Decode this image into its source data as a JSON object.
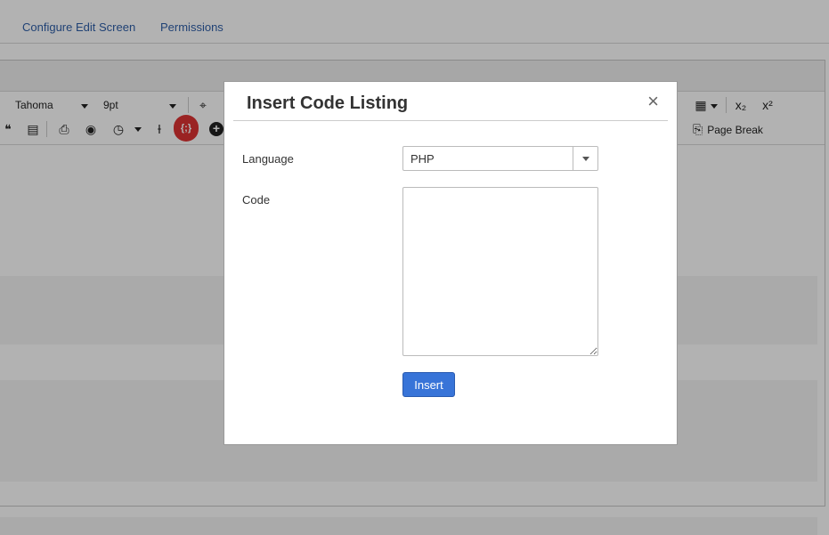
{
  "top_tabs": [
    "Configure Edit Screen",
    "Permissions"
  ],
  "toolbar": {
    "font_family": "Tahoma",
    "font_size": "9pt",
    "page_break_label": "Page Break",
    "subscript_icon": "x₂",
    "superscript_icon": "x²",
    "code_icon": "{;}"
  },
  "colors": {
    "link": "#2f5fa8",
    "insert_button": "#3874d8",
    "code_snippet_button": "#dd3333"
  },
  "modal": {
    "title": "Insert Code Listing",
    "close_icon": "×",
    "language_label": "Language",
    "language_value": "PHP",
    "code_label": "Code",
    "code_value": "",
    "insert_label": "Insert"
  }
}
